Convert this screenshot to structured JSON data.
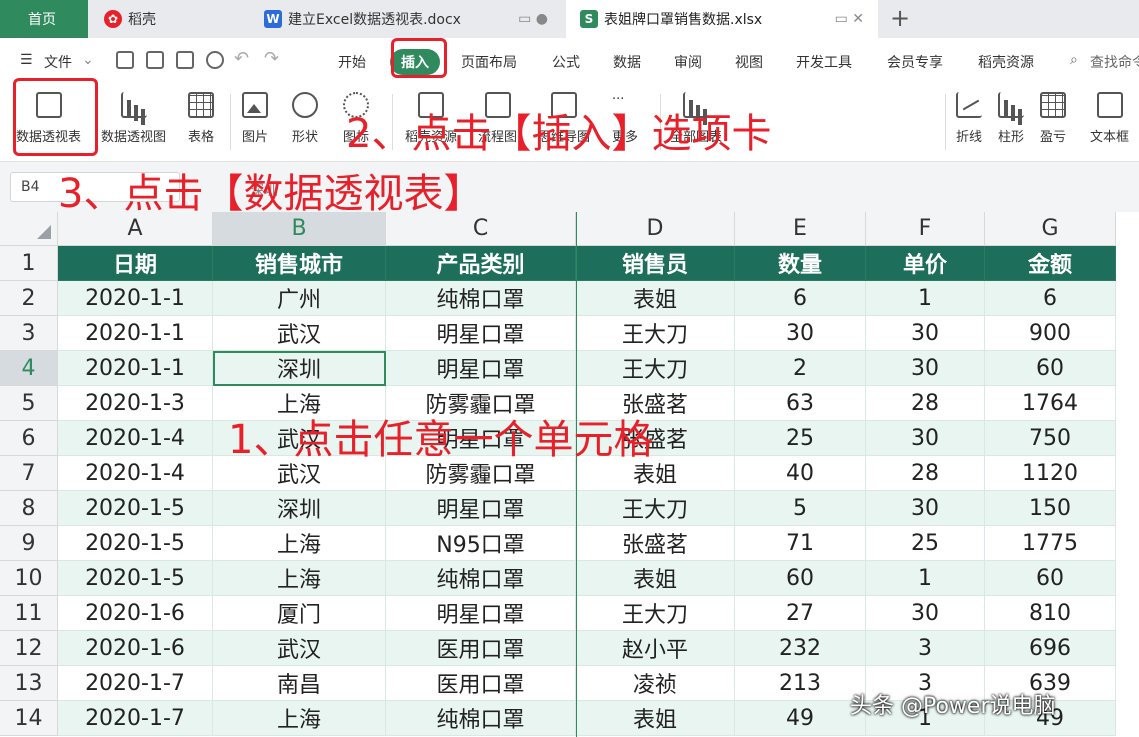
{
  "tabs": {
    "home": "首页",
    "daoke": "稻壳",
    "doc": "建立Excel数据透视表.docx",
    "xls": "表姐牌口罩销售数据.xlsx",
    "doc_icon": "W",
    "xls_icon": "S"
  },
  "menu": {
    "file": "文件",
    "start": "开始",
    "insert": "插入",
    "page_layout": "页面布局",
    "formula": "公式",
    "data": "数据",
    "review": "审阅",
    "view": "视图",
    "dev": "开发工具",
    "member": "会员专享",
    "resources": "稻壳资源",
    "search": "查找命令"
  },
  "ribbon": {
    "pivot_table": "数据透视表",
    "pivot_chart": "数据透视图",
    "table": "表格",
    "picture": "图片",
    "shape": "形状",
    "icon": "图标",
    "daoke_res": "稻壳资源",
    "flowchart": "流程图",
    "mindmap": "思维导图",
    "more": "更多",
    "all_charts": "全部图表",
    "line": "折线",
    "column": "柱形",
    "winloss": "盈亏",
    "textbox": "文本框"
  },
  "formula_bar": {
    "cell_ref": "B4",
    "content": "深圳"
  },
  "annotations": {
    "step1": "1、点击任意一个单元格",
    "step2": "2、点击【插入】选项卡",
    "step3": "3、点击【数据透视表】"
  },
  "sheet": {
    "columns": [
      "A",
      "B",
      "C",
      "D",
      "E",
      "F",
      "G"
    ],
    "headers": [
      "日期",
      "销售城市",
      "产品类别",
      "销售员",
      "数量",
      "单价",
      "金额"
    ],
    "rows": [
      [
        "2020-1-1",
        "广州",
        "纯棉口罩",
        "表姐",
        "6",
        "1",
        "6"
      ],
      [
        "2020-1-1",
        "武汉",
        "明星口罩",
        "王大刀",
        "30",
        "30",
        "900"
      ],
      [
        "2020-1-1",
        "深圳",
        "明星口罩",
        "王大刀",
        "2",
        "30",
        "60"
      ],
      [
        "2020-1-3",
        "上海",
        "防雾霾口罩",
        "张盛茗",
        "63",
        "28",
        "1764"
      ],
      [
        "2020-1-4",
        "武汉",
        "明星口罩",
        "张盛茗",
        "25",
        "30",
        "750"
      ],
      [
        "2020-1-4",
        "武汉",
        "防雾霾口罩",
        "表姐",
        "40",
        "28",
        "1120"
      ],
      [
        "2020-1-5",
        "深圳",
        "明星口罩",
        "王大刀",
        "5",
        "30",
        "150"
      ],
      [
        "2020-1-5",
        "上海",
        "N95口罩",
        "张盛茗",
        "71",
        "25",
        "1775"
      ],
      [
        "2020-1-5",
        "上海",
        "纯棉口罩",
        "表姐",
        "60",
        "1",
        "60"
      ],
      [
        "2020-1-6",
        "厦门",
        "明星口罩",
        "王大刀",
        "27",
        "30",
        "810"
      ],
      [
        "2020-1-6",
        "武汉",
        "医用口罩",
        "赵小平",
        "232",
        "3",
        "696"
      ],
      [
        "2020-1-7",
        "南昌",
        "医用口罩",
        "凌祯",
        "213",
        "3",
        "639"
      ],
      [
        "2020-1-7",
        "上海",
        "纯棉口罩",
        "表姐",
        "49",
        "1",
        "49"
      ]
    ],
    "row_numbers": [
      "1",
      "2",
      "3",
      "4",
      "5",
      "6",
      "7",
      "8",
      "9",
      "10",
      "11",
      "12",
      "13",
      "14"
    ]
  },
  "watermark": "头条 @Power说电脑"
}
